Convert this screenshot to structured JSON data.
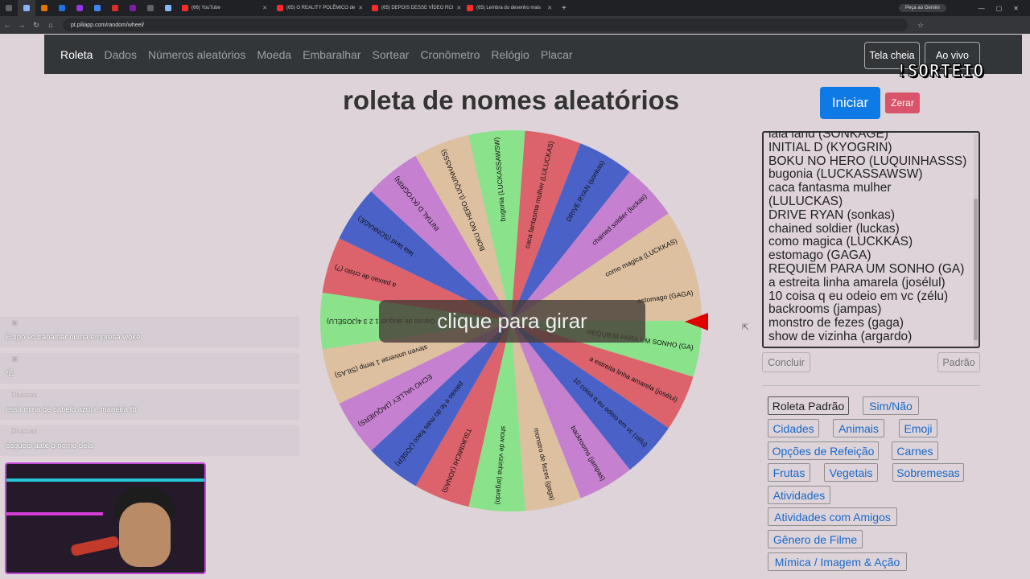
{
  "browser": {
    "tabs": [
      {
        "title": "",
        "pinned": true
      },
      {
        "title": "",
        "pinned": true
      },
      {
        "title": "",
        "pinned": true
      },
      {
        "title": "",
        "pinned": true
      },
      {
        "title": "",
        "pinned": true
      },
      {
        "title": "",
        "pinned": true
      },
      {
        "title": "",
        "pinned": true
      },
      {
        "title": "",
        "pinned": true
      },
      {
        "title": "",
        "pinned": true
      },
      {
        "title": "",
        "pinned": true
      },
      {
        "title": "(66) YouTube",
        "pinned": false
      },
      {
        "title": "(65) O REALITY POLÊMICO de",
        "pinned": false
      },
      {
        "title": "(65) DEPOIS DESSE VÍDEO RCI",
        "pinned": false
      },
      {
        "title": "(65) Lembra do desenho mais",
        "pinned": false
      }
    ],
    "gemini_label": "Peça ao Gemini",
    "url": "pt.piliapp.com/random/wheel/"
  },
  "nav": {
    "links": [
      "Roleta",
      "Dados",
      "Números aleatórios",
      "Moeda",
      "Embaralhar",
      "Sortear",
      "Cronômetro",
      "Relógio",
      "Placar"
    ],
    "fullscreen": "Tela cheia",
    "live": "Ao vivo"
  },
  "watermark": "!SORTEIO",
  "title": "roleta de nomes aleatórios",
  "start_button": "Iniciar",
  "reset_button": "Zerar",
  "spin_prompt": "clique para girar",
  "wheel": {
    "colors": [
      "#dcc0a0",
      "#c580cf",
      "#4a62c8",
      "#dc626c",
      "#8ae28a"
    ],
    "labels": [
      "como magica (LUCKKAS)",
      "chained soldier (luckas)",
      "DRIVE RYAN (sonkas)",
      "caca fantasma mulher (LULUCKAS)",
      "bugonia (LUCKASSAWSW)",
      "BOKU NO HERO (LUQUINHASSS)",
      "INITIAL D (KYOGRIN)",
      "lala land (SONKAGE)",
      "a paixao de cristo (?)",
      "Garota de aluguel 1 2 3 4(JOSÉLU)",
      "steven universe 1 temp (SILAS)",
      "ECHO VALLEY (JAQUIERS)",
      "paixao e fe do mais fraco (JOSÉR)",
      "TSUKIMICHI (JONAS)",
      "show de vizinha (argardo)",
      "monstro de fezes (gaga)",
      "backrooms (jampas)",
      "10 coisa q eu odeio em vc (zélu)",
      "a estreita linha amarela (josélul)",
      "REQUIEM PARA UM SONHO (GA)",
      "estomago (GAGA)"
    ]
  },
  "names_list": [
    "lala land (SONKAGE)",
    "INITIAL D (KYOGRIN)",
    "BOKU NO HERO (LUQUINHASSS)",
    "bugonia (LUCKASSAWSW)",
    "caca fantasma mulher",
    "(LULUCKAS)",
    "DRIVE RYAN (sonkas)",
    "chained soldier (luckas)",
    "como magica (LUCKKAS)",
    "estomago (GAGA)",
    "REQUIEM PARA UM SONHO (GA)",
    "a estreita linha amarela (josélul)",
    "10 coisa q eu odeio em vc (zélu)",
    "backrooms (jampas)",
    "monstro de fezes (gaga)",
    "show de vizinha (argardo)"
  ],
  "conclude_button": "Concluir",
  "default_button": "Padrão",
  "presets": [
    "Roleta Padrão",
    "Sim/Não",
    "Cidades",
    "Animais",
    "Emoji",
    "Opções de Refeição",
    "Carnes",
    "Frutas",
    "Vegetais",
    "Sobremesas",
    "Atividades",
    "Atividades com Amigos",
    "Gênero de Filme",
    "Mímica / Imagem & Ação"
  ],
  "chat": [
    {
      "text": "E tipo vc trabalhar numa empresa woke"
    },
    {
      "text": "*É"
    },
    {
      "user": "Dluccas",
      "text": "essa mina de cabelo azul é maneira tb"
    },
    {
      "user": "Dluccas",
      "text": "esqueci aatè o nome dela"
    }
  ]
}
